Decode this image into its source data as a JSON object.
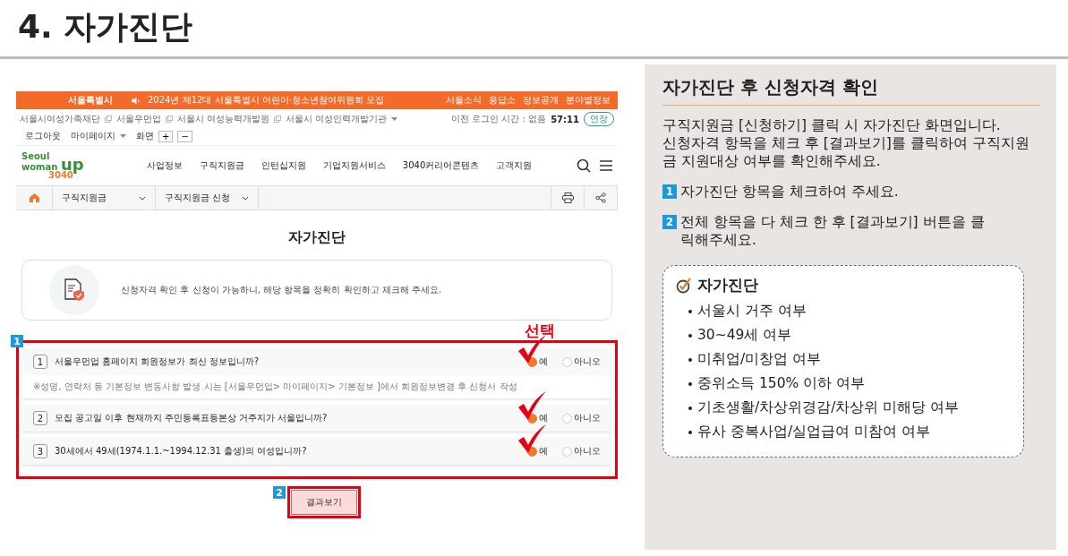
{
  "heading": "4. 자가진단",
  "site": {
    "topbar": {
      "brand": "서울특별시",
      "notice": "2024년 제12대 서울특별시 어린이·청소년참여위원회 모집",
      "links": [
        "서울소식",
        "응답소",
        "정보공개",
        "분야별정보"
      ]
    },
    "utility": {
      "family_links": [
        {
          "label": "서울시여성가족재단",
          "external": true
        },
        {
          "label": "서울우먼업",
          "external": true
        },
        {
          "label": "서울시 여성능력개발원",
          "external": true
        },
        {
          "label": "서울시 여성인력개발기관",
          "external": false
        }
      ],
      "login_time": "이전 로그인 시간 : 없음",
      "timer": "57:11",
      "extend": "연장",
      "logout": "로그아웃",
      "mypage": "마이페이지",
      "zoom_label": "화면",
      "zoom_in": "+",
      "zoom_out": "−"
    },
    "logo": {
      "line_1": "Seoul",
      "line_2": "woman",
      "line_3": "up",
      "line_4": "3040"
    },
    "nav": [
      "사업정보",
      "구직지원금",
      "인턴십지원",
      "기업지원서비스",
      "3040커리어콘텐츠",
      "고객지원"
    ],
    "breadcrumb": [
      "구직지원금",
      "구직지원금 신청"
    ],
    "page_title": "자가진단",
    "notice": "신청자격 확인 후 신청이 가능하니, 해당 항목을 정확히 확인하고 체크해 주세요.",
    "questions": [
      {
        "number": "1",
        "text": "서울우먼업 홈페이지 회원정보가 최신 정보입니까?",
        "note": "※성명, 연락처 등 기본정보 변동사항 발생 시는 [서울우먼업> 마이페이지> 기본정보 ]에서 회원정보변경 후 신청서 작성",
        "options": [
          {
            "label": "예",
            "selected": true
          },
          {
            "label": "아니오",
            "selected": false
          }
        ]
      },
      {
        "number": "2",
        "text": "모집 공고일 이후 현재까지 주민등록표등본상 거주지가 서울입니까?",
        "options": [
          {
            "label": "예",
            "selected": true
          },
          {
            "label": "아니오",
            "selected": false
          }
        ]
      },
      {
        "number": "3",
        "text": "30세에서 49세(1974.1.1.~1994.12.31 출생)의 여성입니까?",
        "options": [
          {
            "label": "예",
            "selected": true
          },
          {
            "label": "아니오",
            "selected": false
          }
        ]
      }
    ],
    "result_button": "결과보기"
  },
  "annotations": {
    "select_label": "선택",
    "step_1": "1",
    "step_2": "2"
  },
  "guide": {
    "title": "자가진단 후 신청자격 확인",
    "description": [
      "구직지원금 [신청하기] 클릭 시 자가진단 화면입니다.",
      "신청자격 항목을 체크 후 [결과보기]를 클릭하여 구직지원금 지원대상 여부를 확인해주세요."
    ],
    "steps": [
      {
        "number": "1",
        "text": "자가진단 항목을 체크하여 주세요."
      },
      {
        "number": "2",
        "text": "전체 항목을 다 체크 한 후 [결과보기] 버튼을 클릭해주세요."
      }
    ],
    "checklist": {
      "title": "자가진단",
      "items": [
        "서울시 거주 여부",
        "30~49세 여부",
        "미취업/미창업 여부",
        "중위소득 150% 이하 여부",
        "기초생활/차상위경감/차상위 미해당 여부",
        "유사 중복사업/실업급여 미참여 여부"
      ]
    }
  }
}
